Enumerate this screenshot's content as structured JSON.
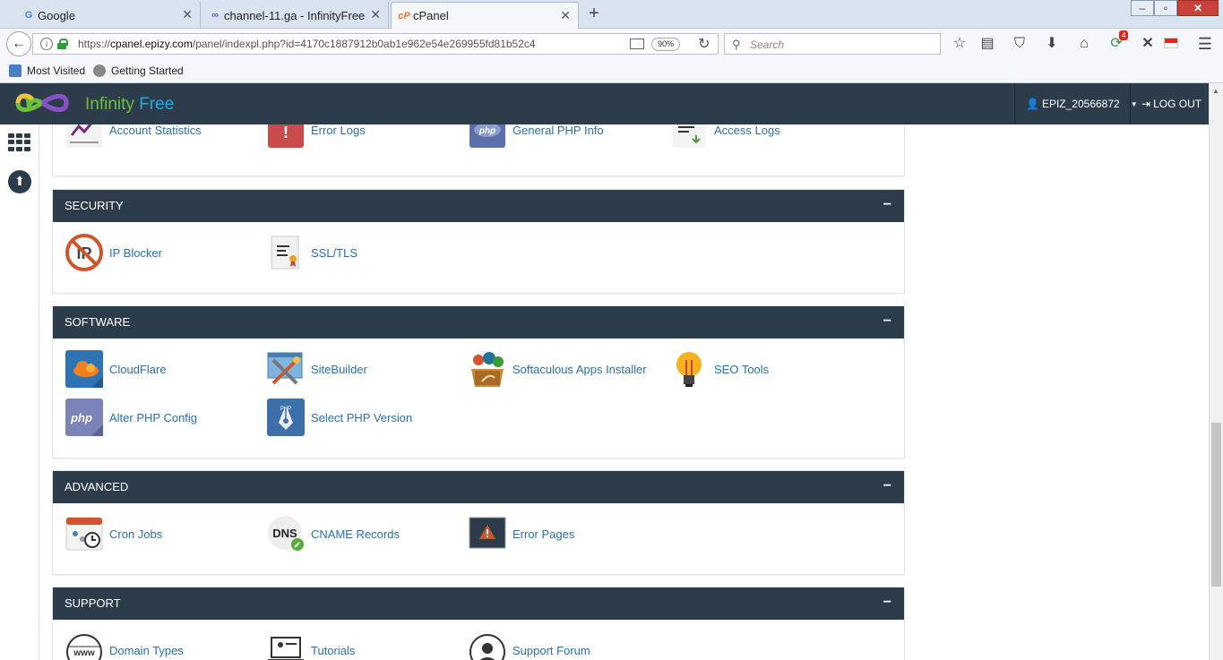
{
  "browser": {
    "tabs": [
      {
        "title": "Google",
        "icon": "google-icon",
        "active": false
      },
      {
        "title": "channel-11.ga - InfinityFree",
        "icon": "infinity-icon",
        "active": false
      },
      {
        "title": "cPanel",
        "icon": "cpanel-icon",
        "active": true
      }
    ],
    "new_tab_symbol": "+",
    "url_host": "cpanel.epizy.com",
    "url_full": "https://cpanel.epizy.com/panel/indexpl.php?id=4170c1887912b0ab1e962e54e269955fd81b52c4",
    "url_prefix": "https://",
    "url_suffix": "/panel/indexpl.php?id=4170c1887912b0ab1e962e54e269955fd81b52c4",
    "zoom": "90%",
    "search_placeholder": "Search",
    "notification_count": "4",
    "bookmarks": [
      "Most Visited",
      "Getting Started"
    ]
  },
  "header": {
    "logo_part1": "Infinity",
    "logo_part2": " Free",
    "username": "EPIZ_20566872",
    "logout_label": "LOG OUT"
  },
  "panels": {
    "stats_items": [
      "Account Statistics",
      "Error Logs",
      "General PHP Info",
      "Access Logs"
    ],
    "security": {
      "title": "SECURITY",
      "items": [
        "IP Blocker",
        "SSL/TLS"
      ]
    },
    "software": {
      "title": "SOFTWARE",
      "items": [
        "CloudFlare",
        "SiteBuilder",
        "Softaculous Apps Installer",
        "SEO Tools",
        "Alter PHP Config",
        "Select PHP Version"
      ]
    },
    "advanced": {
      "title": "ADVANCED",
      "items": [
        "Cron Jobs",
        "CNAME Records",
        "Error Pages"
      ]
    },
    "support": {
      "title": "SUPPORT",
      "items": [
        "Domain Types",
        "Tutorials",
        "Support Forum"
      ]
    },
    "collapse_symbol": "−"
  },
  "icon_text": {
    "php": "php",
    "dns": "DNS",
    "error": "!"
  },
  "colors": {
    "header_bg": "#2d3c4b",
    "link": "#2a6fb0",
    "logo_green": "#6bbf3a",
    "logo_blue": "#2aa7dc"
  }
}
